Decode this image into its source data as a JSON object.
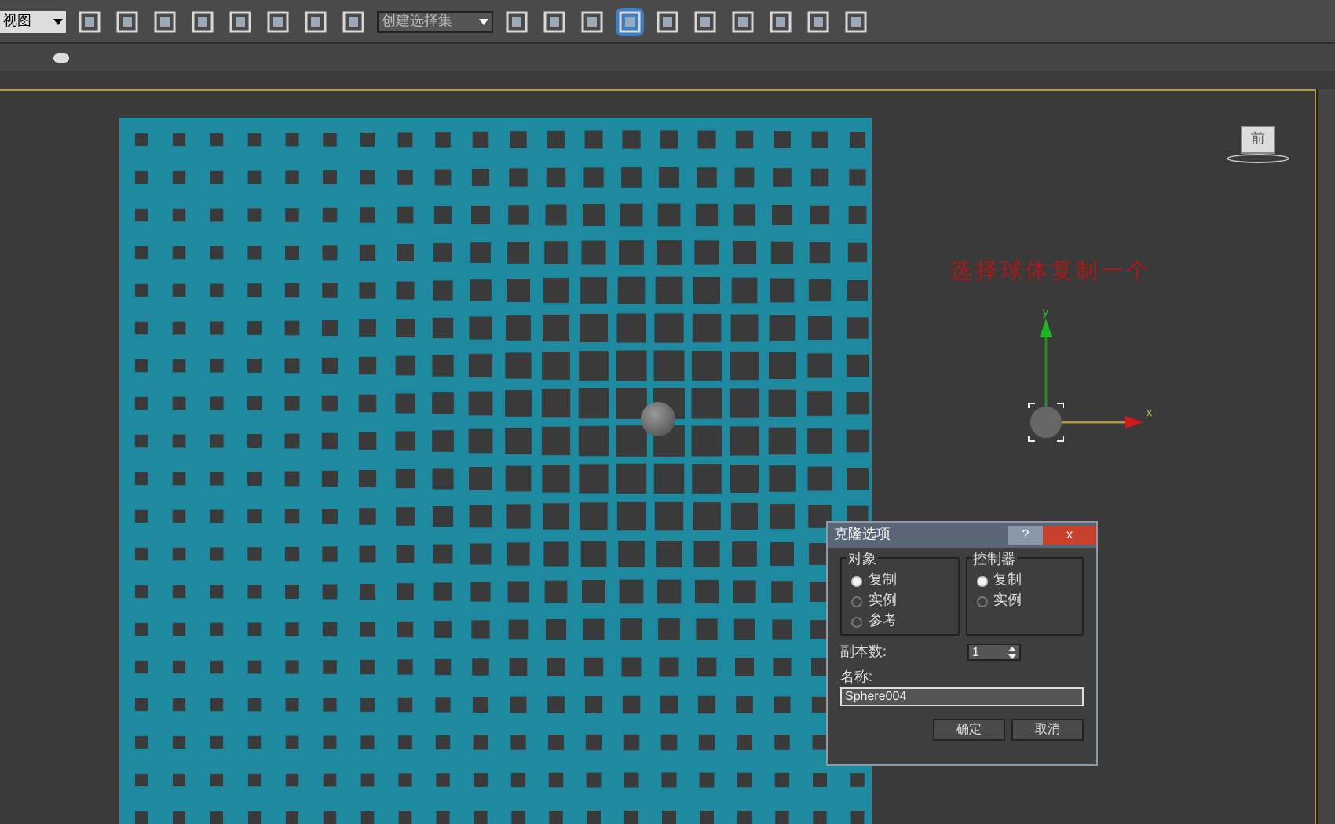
{
  "toolbar": {
    "view_dropdown": {
      "value": "视图"
    },
    "selection_set_dropdown": {
      "placeholder": "创建选择集"
    }
  },
  "viewport": {
    "viewcube_label": "前",
    "annotation": "选择球体复制一个",
    "gizmo": {
      "x_label": "x",
      "y_label": "y"
    }
  },
  "clone_dialog": {
    "title": "克隆选项",
    "help_button": "?",
    "close_button": "x",
    "object_group": {
      "title": "对象",
      "options": [
        {
          "label": "复制",
          "selected": true
        },
        {
          "label": "实例",
          "selected": false
        },
        {
          "label": "参考",
          "selected": false
        }
      ]
    },
    "controller_group": {
      "title": "控制器",
      "options": [
        {
          "label": "复制",
          "selected": true
        },
        {
          "label": "实例",
          "selected": false
        }
      ]
    },
    "copies": {
      "label": "副本数:",
      "value": "1"
    },
    "name": {
      "label": "名称:",
      "value": "Sphere004"
    },
    "buttons": [
      "确定",
      "取消"
    ]
  }
}
